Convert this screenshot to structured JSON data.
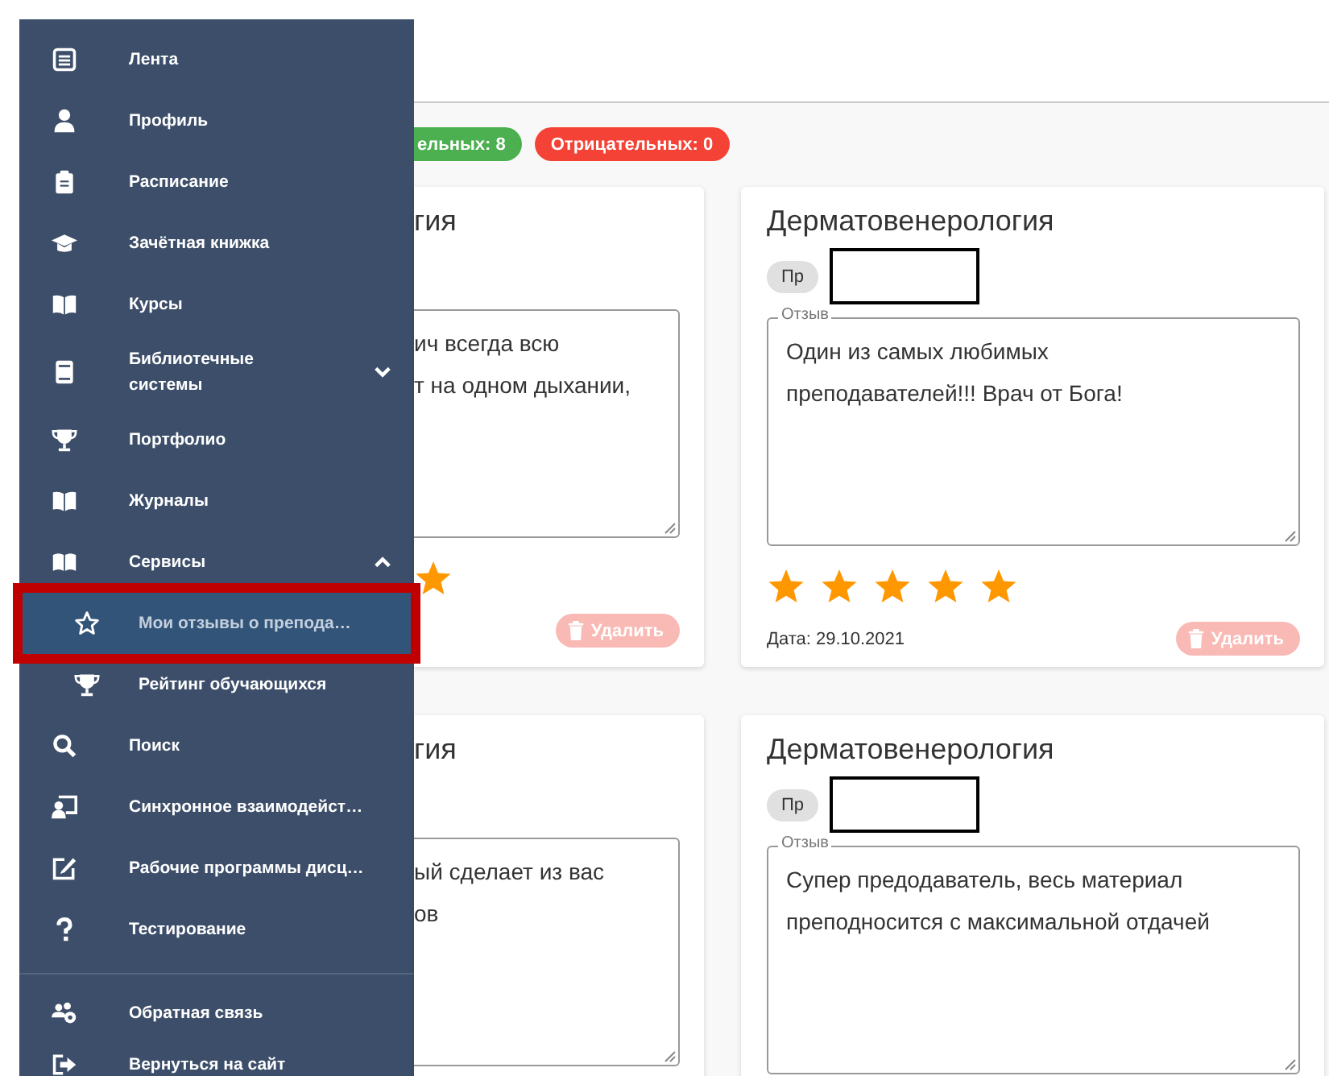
{
  "sidebar": {
    "items": [
      {
        "label": "Лента",
        "selected": false
      },
      {
        "label": "Профиль",
        "selected": false
      },
      {
        "label": "Расписание",
        "selected": false
      },
      {
        "label": "Зачётная книжка",
        "selected": false
      },
      {
        "label": "Курсы",
        "selected": false
      },
      {
        "label": "Библиотечные системы",
        "selected": false,
        "expanded": false
      },
      {
        "label": "Портфолио",
        "selected": false
      },
      {
        "label": "Журналы",
        "selected": false
      },
      {
        "label": "Сервисы",
        "selected": false,
        "expanded": true,
        "children": [
          {
            "label": "Мои отзывы о препода…",
            "selected": true
          },
          {
            "label": "Рейтинг обучающихся",
            "selected": false
          }
        ]
      },
      {
        "label": "Поиск",
        "selected": false
      },
      {
        "label": "Синхронное взаимодейст…",
        "selected": false
      },
      {
        "label": "Рабочие программы дисц…",
        "selected": false
      },
      {
        "label": "Тестирование",
        "selected": false
      }
    ],
    "footer_items": [
      {
        "label": "Обратная связь",
        "selected": false
      },
      {
        "label": "Вернуться на сайт",
        "selected": false
      }
    ]
  },
  "summary_chips": [
    {
      "label": "ельных: 8",
      "color": "#4caf50",
      "kind": "clipped"
    },
    {
      "label": "Отрицательных: 0",
      "color": "#f44336",
      "kind": "full"
    }
  ],
  "cards": [
    {
      "kind": "clipped",
      "title": "гия",
      "review": "ич всегда всю\nт на одном дыхании,",
      "delete": "Удалить"
    },
    {
      "kind": "full",
      "title": "Дерматовенерология",
      "tag": "Пр",
      "review_label": "Отзыв",
      "review": "Один из самых любимых\nпреподавателей!!! Врач от Бога!",
      "stars": 5,
      "date": "Дата: 29.10.2021",
      "delete": "Удалить"
    },
    {
      "kind": "clipped",
      "title": "гия",
      "review": "ый сделает из вас\nов"
    },
    {
      "kind": "full",
      "title": "Дерматовенерология",
      "tag": "Пр",
      "review_label": "Отзыв",
      "review": "Супер предодаватель, весь материал\nпреподносится с максимальной отдачей"
    }
  ]
}
